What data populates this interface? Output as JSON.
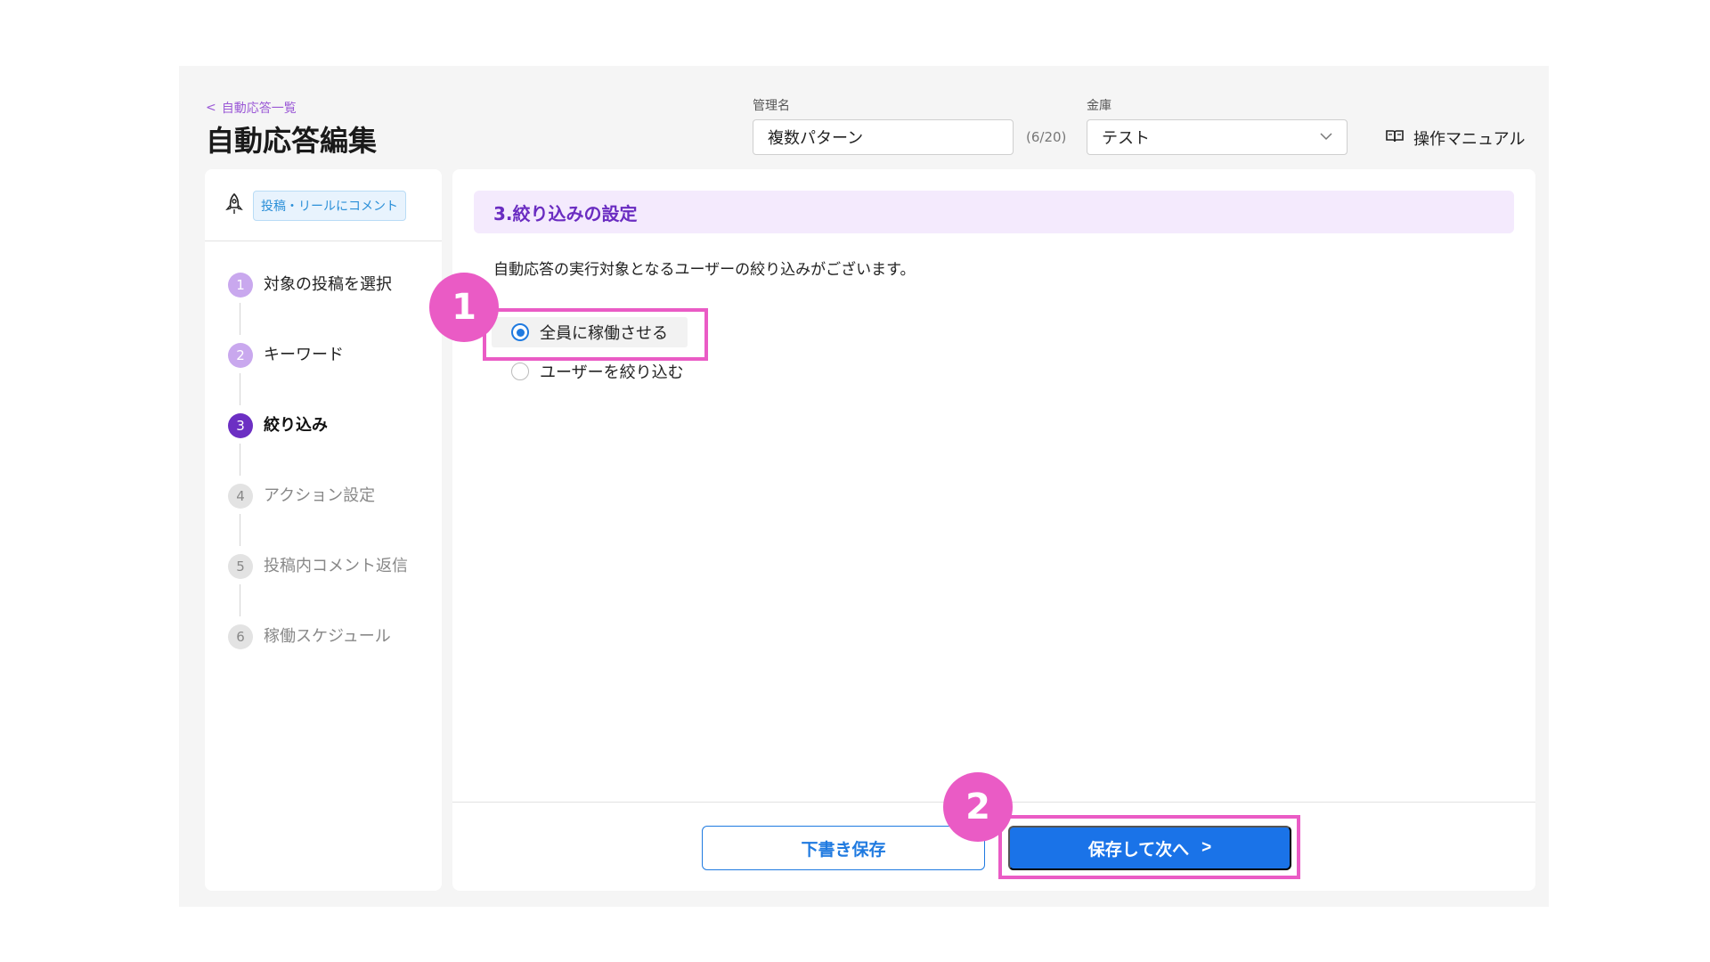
{
  "header": {
    "back_label": "自動応答一覧",
    "title": "自動応答編集",
    "name_label": "管理名",
    "name_value": "複数パターン",
    "name_count": "(6/20)",
    "vault_label": "金庫",
    "vault_value": "テスト",
    "manual_label": "操作マニュアル"
  },
  "sidebar": {
    "trigger_badge": "投稿・リールにコメント",
    "steps": [
      {
        "num": "1",
        "label": "対象の投稿を選択",
        "state": "done"
      },
      {
        "num": "2",
        "label": "キーワード",
        "state": "done"
      },
      {
        "num": "3",
        "label": "絞り込み",
        "state": "active"
      },
      {
        "num": "4",
        "label": "アクション設定",
        "state": "todo"
      },
      {
        "num": "5",
        "label": "投稿内コメント返信",
        "state": "todo"
      },
      {
        "num": "6",
        "label": "稼働スケジュール",
        "state": "todo"
      }
    ]
  },
  "main": {
    "section_title": "3.絞り込みの設定",
    "description": "自動応答の実行対象となるユーザーの絞り込みがございます。",
    "options": [
      {
        "label": "全員に稼働させる",
        "checked": true
      },
      {
        "label": "ユーザーを絞り込む",
        "checked": false
      }
    ],
    "draft_button": "下書き保存",
    "next_button": "保存して次へ",
    "next_chevron": ">"
  },
  "annotations": {
    "callout_1": "1",
    "callout_2": "2",
    "color": "#ea5bc5"
  },
  "colors": {
    "accent_purple": "#6c2fc3",
    "primary_blue": "#1a73e8",
    "highlight_pink": "#ea5bc5"
  }
}
